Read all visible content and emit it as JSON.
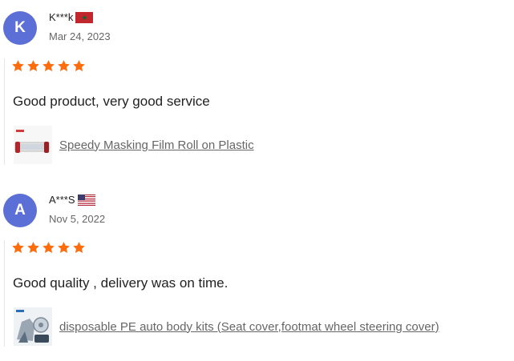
{
  "reviews": [
    {
      "avatar_letter": "K",
      "avatar_color": "#5b6fd6",
      "name": "K***k",
      "country_flag": "morocco-flag",
      "date": "Mar 24, 2023",
      "rating": 5,
      "star_color": "#fd6c0d",
      "text": "Good product, very good service",
      "product": {
        "thumb": "masking-film-roll-thumbnail",
        "name": "Speedy Masking Film Roll on Plastic"
      }
    },
    {
      "avatar_letter": "A",
      "avatar_color": "#5b6fd6",
      "name": "A***S",
      "country_flag": "usa-flag",
      "date": "Nov 5, 2022",
      "rating": 5,
      "star_color": "#fd6c0d",
      "text": "Good quality , delivery was on time.",
      "product": {
        "thumb": "auto-body-kit-thumbnail",
        "name": "disposable PE auto body kits (Seat cover,footmat wheel steering cover)"
      }
    }
  ]
}
